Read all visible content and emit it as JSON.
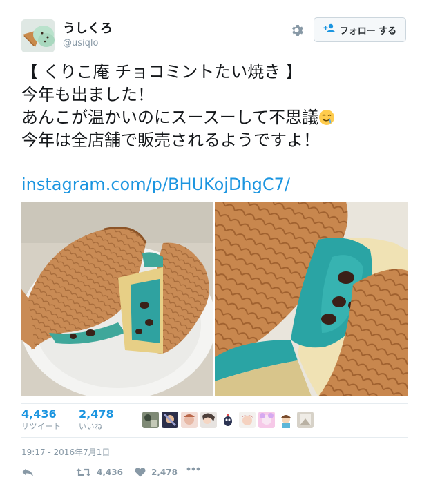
{
  "user": {
    "display_name": "うしくろ",
    "screen_name": "@usiqlo",
    "avatar_icon": "mint-soft-serve-avatar"
  },
  "follow_button": {
    "label": "フォロー する"
  },
  "settings_icon": "gear-icon",
  "tweet": {
    "lines": [
      "【 くりこ庵 チョコミントたい焼き 】",
      "今年も出ました！",
      "あんこが温かいのにスースーして不思議",
      "今年は全店舗で販売されるようですよ！"
    ],
    "emoji": "drooling-face-emoji",
    "link": "instagram.com/p/BHUKojDhgC7/"
  },
  "media": [
    {
      "name": "photo-taiyaki-plate"
    },
    {
      "name": "photo-taiyaki-closeup"
    }
  ],
  "stats": {
    "retweets": {
      "count": "4,436",
      "label": "リツイート"
    },
    "likes": {
      "count": "2,478",
      "label": "いいね"
    },
    "liker_avatar_count": 9
  },
  "timestamp": "19:17 - 2016年7月1日",
  "actions": {
    "reply_icon": "reply-icon",
    "retweet_count": "4,436",
    "like_count": "2,478",
    "more_icon": "more-icon"
  },
  "colors": {
    "link": "#1b95e0",
    "text": "#14171a",
    "muted": "#8899a6",
    "divider": "#e6ecf0"
  }
}
